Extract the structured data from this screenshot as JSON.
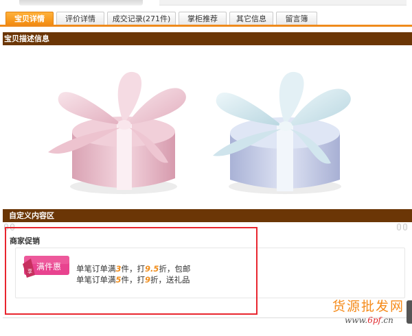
{
  "tabs": [
    {
      "label": "宝贝详情",
      "active": true
    },
    {
      "label": "评价详情",
      "active": false
    },
    {
      "label": "成交记录(271件)",
      "active": false
    },
    {
      "label": "掌柜推荐",
      "active": false
    },
    {
      "label": "其它信息",
      "active": false
    },
    {
      "label": "留言簿",
      "active": false
    }
  ],
  "sections": {
    "description_header": "宝贝描述信息",
    "custom_header": "自定义内容区"
  },
  "promo": {
    "title": "商家促销",
    "badge_text": "满件惠",
    "badge_tag": "享",
    "line1": {
      "a": "单笔订单满",
      "n1": "3",
      "b": "件，打",
      "n2": "9.5",
      "c": "折，包邮"
    },
    "line2": {
      "a": "单笔订单满",
      "n1": "5",
      "b": "件，打",
      "n2": "9",
      "c": "折，送礼品"
    }
  },
  "watermark": {
    "title": "货源批发网",
    "url_prefix": "www.",
    "url_main": "6pf",
    "url_suffix": ".cn"
  },
  "colors": {
    "tab_active": "#f28a0f",
    "tab_underline": "#ef8a1b",
    "section_header": "#6b3606",
    "highlight_outline": "#e8242d",
    "promo_number": "#f08c1a",
    "badge_pink": "#e8438f"
  },
  "icons": {
    "gift_pink": "gift-box-pink",
    "gift_blue": "gift-box-blue",
    "badge": "promo-badge"
  }
}
